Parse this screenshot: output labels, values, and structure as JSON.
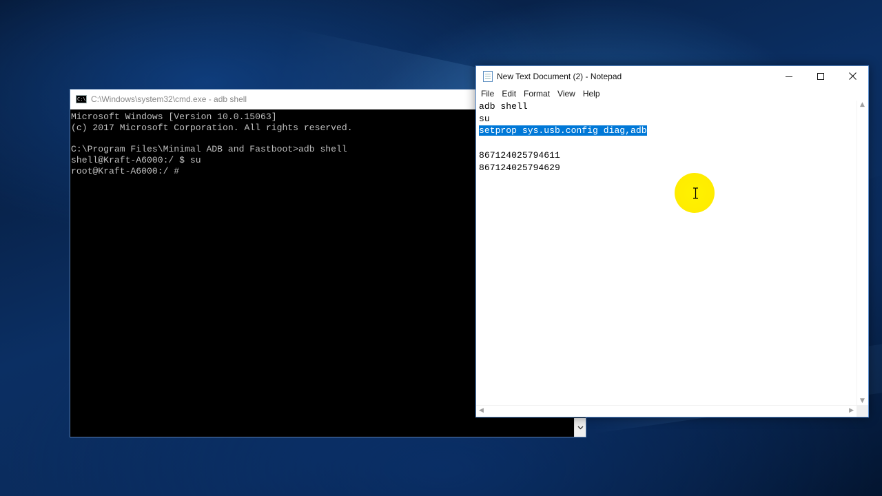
{
  "cmd": {
    "title": "C:\\Windows\\system32\\cmd.exe - adb  shell",
    "lines": [
      "Microsoft Windows [Version 10.0.15063]",
      "(c) 2017 Microsoft Corporation. All rights reserved.",
      "",
      "C:\\Program Files\\Minimal ADB and Fastboot>adb shell",
      "shell@Kraft-A6000:/ $ su",
      "root@Kraft-A6000:/ #"
    ]
  },
  "notepad": {
    "title": "New Text Document (2) - Notepad",
    "menu": [
      "File",
      "Edit",
      "Format",
      "View",
      "Help"
    ],
    "lines": [
      "adb shell",
      "su",
      "setprop sys.usb.config diag,adb",
      "",
      "867124025794611",
      "867124025794629"
    ],
    "selected_line_index": 2
  },
  "icons": {
    "cmd": "console-icon",
    "notepad": "notepad-icon",
    "minimize": "minimize-icon",
    "maximize": "maximize-icon",
    "close": "close-icon",
    "cursor": "text-cursor-icon"
  },
  "colors": {
    "selection": "#0078d7",
    "cursor_highlight": "#ffec00",
    "console_text": "#c0c0c0"
  }
}
